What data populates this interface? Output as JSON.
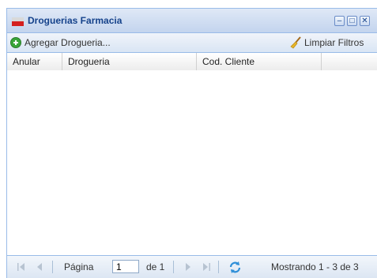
{
  "window": {
    "title": "Droguerias Farmacia"
  },
  "toolbar": {
    "add_label": "Agregar Drogueria...",
    "clear_label": "Limpiar Filtros"
  },
  "grid": {
    "columns": [
      "Anular",
      "Drogueria",
      "Cod. Cliente"
    ]
  },
  "pager": {
    "page_label": "Página",
    "page_value": "1",
    "of_label": "de 1",
    "display_info": "Mostrando 1 - 3 de 3"
  },
  "icons": [
    "window-icon",
    "minimize-icon",
    "maximize-icon",
    "close-icon",
    "add-icon",
    "broom-icon",
    "first-page-icon",
    "prev-page-icon",
    "next-page-icon",
    "last-page-icon",
    "refresh-icon"
  ],
  "colors": {
    "title": "#15428b",
    "border": "#99bbe8",
    "add_icon": "#3aa53a"
  }
}
